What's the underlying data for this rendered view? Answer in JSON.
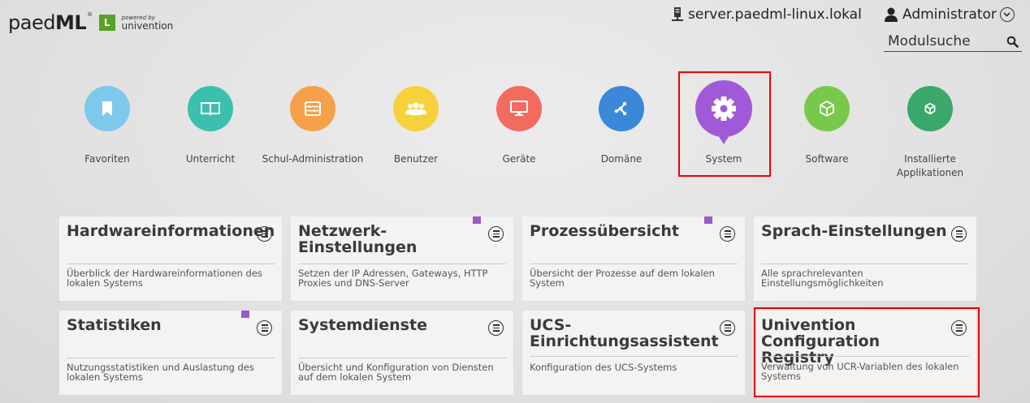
{
  "header": {
    "logo": {
      "name_regular": "paed",
      "name_bold": "ML",
      "reg": "®",
      "badge": "L",
      "powered_by": "powered by",
      "brand": "univention"
    },
    "server": "server.paedml-linux.lokal",
    "user": "Administrator",
    "search_label": "Modulsuche"
  },
  "categories": [
    {
      "label": "Favoriten",
      "color": "#7ec8ec",
      "icon": "bookmark-icon"
    },
    {
      "label": "Unterricht",
      "color": "#3dbfad",
      "icon": "book-icon"
    },
    {
      "label": "Schul-Administration",
      "color": "#f7a04a",
      "icon": "abacus-icon"
    },
    {
      "label": "Benutzer",
      "color": "#f5d23c",
      "icon": "users-icon"
    },
    {
      "label": "Geräte",
      "color": "#f36b5f",
      "icon": "monitor-icon"
    },
    {
      "label": "Domäne",
      "color": "#3b88d8",
      "icon": "network-icon"
    },
    {
      "label": "System",
      "color": "#a05ad8",
      "icon": "gear-icon",
      "selected": true
    },
    {
      "label": "Software",
      "color": "#78c94a",
      "icon": "box-icon"
    },
    {
      "label": "Installierte\nApplikationen",
      "label_line1": "Installierte",
      "label_line2": "Applikationen",
      "color": "#3aa86b",
      "icon": "box-small-icon"
    }
  ],
  "tiles": [
    {
      "title": "Hardwareinformationen",
      "desc": "Überblick der Hardwareinformationen des lokalen Systems",
      "favorite": false
    },
    {
      "title": "Netzwerk-Einstellungen",
      "desc": "Setzen der IP Adressen, Gateways, HTTP Proxies und DNS-Server",
      "favorite": true
    },
    {
      "title": "Prozessübersicht",
      "desc": "Übersicht der Prozesse auf dem lokalen System",
      "favorite": true
    },
    {
      "title": "Sprach-Einstellungen",
      "desc": "Alle sprachrelevanten Einstellungsmöglichkeiten",
      "favorite": false
    },
    {
      "title": "Statistiken",
      "desc": "Nutzungsstatistiken und Auslastung des lokalen Systems",
      "favorite": true
    },
    {
      "title": "Systemdienste",
      "desc": "Übersicht und Konfiguration von Diensten auf dem lokalen System",
      "favorite": false
    },
    {
      "title": "UCS-Einrichtungsassistent",
      "title_line1": "UCS-",
      "title_line2": "Einrichtungsassistent",
      "desc": "Konfiguration des UCS-Systems",
      "favorite": false
    },
    {
      "title": "Univention Configuration Registry",
      "title_line1": "Univention",
      "title_line2": "Configuration Registry",
      "desc": "Verwaltung von UCR-Variablen des lokalen Systems",
      "favorite": false
    }
  ]
}
